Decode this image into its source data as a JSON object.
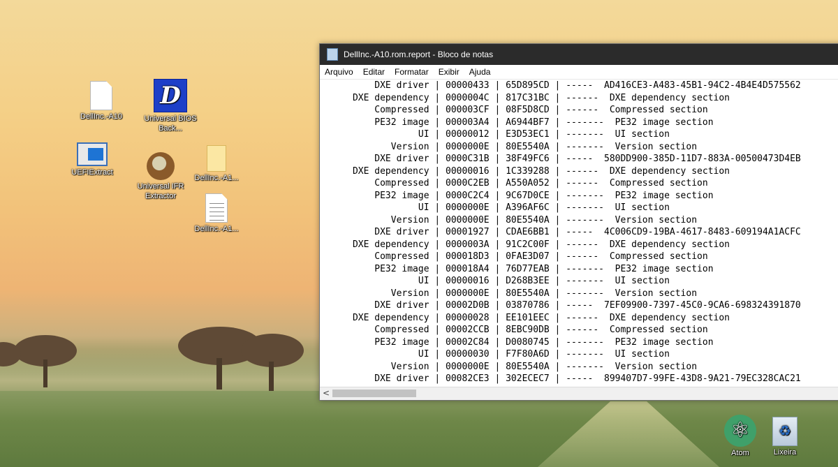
{
  "desktop": {
    "icons": [
      {
        "label": "DellInc.-A10"
      },
      {
        "label": "Universal BIOS Back..."
      },
      {
        "label": "UEFIExtract"
      },
      {
        "label": "Universal IFR Extractor"
      },
      {
        "label": "DellInc.-A1..."
      },
      {
        "label": "DellInc.-A1..."
      },
      {
        "label": "Atom"
      },
      {
        "label": "Lixeira"
      }
    ]
  },
  "window": {
    "title": "DellInc.-A10.rom.report - Bloco de notas",
    "menu": [
      {
        "label": "Arquivo"
      },
      {
        "label": "Editar"
      },
      {
        "label": "Formatar"
      },
      {
        "label": "Exibir"
      },
      {
        "label": "Ajuda"
      }
    ],
    "lines": [
      "          DXE driver | 00000433 | 65D895CD | -----  AD416CE3-A483-45B1-94C2-4B4E4D575562",
      "      DXE dependency | 0000004C | 817C31BC | ------  DXE dependency section",
      "          Compressed | 000003CF | 08F5D8CD | ------  Compressed section",
      "          PE32 image | 000003A4 | A6944BF7 | -------  PE32 image section",
      "                  UI | 00000012 | E3D53EC1 | -------  UI section",
      "             Version | 0000000E | 80E5540A | -------  Version section",
      "          DXE driver | 0000C31B | 38F49FC6 | -----  580DD900-385D-11D7-883A-00500473D4EB",
      "      DXE dependency | 00000016 | 1C339288 | ------  DXE dependency section",
      "          Compressed | 0000C2EB | A550A052 | ------  Compressed section",
      "          PE32 image | 0000C2C4 | 9C67D0CE | -------  PE32 image section",
      "                  UI | 0000000E | A396AF6C | -------  UI section",
      "             Version | 0000000E | 80E5540A | -------  Version section",
      "          DXE driver | 00001927 | CDAE6BB1 | -----  4C006CD9-19BA-4617-8483-609194A1ACFC",
      "      DXE dependency | 0000003A | 91C2C00F | ------  DXE dependency section",
      "          Compressed | 000018D3 | 0FAE3D07 | ------  Compressed section",
      "          PE32 image | 000018A4 | 76D77EAB | -------  PE32 image section",
      "                  UI | 00000016 | D268B3EE | -------  UI section",
      "             Version | 0000000E | 80E5540A | -------  Version section",
      "          DXE driver | 00002D0B | 03870786 | -----  7EF09900-7397-45C0-9CA6-698324391870",
      "      DXE dependency | 00000028 | EE101EEC | ------  DXE dependency section",
      "          Compressed | 00002CCB | 8EBC90DB | ------  Compressed section",
      "          PE32 image | 00002C84 | D0080745 | -------  PE32 image section",
      "                  UI | 00000030 | F7F80A6D | -------  UI section",
      "             Version | 0000000E | 80E5540A | -------  Version section",
      "          DXE driver | 00082CE3 | 302ECEC7 | -----  899407D7-99FE-43D8-9A21-79EC328CAC21"
    ],
    "scroll_arrow": "<"
  }
}
